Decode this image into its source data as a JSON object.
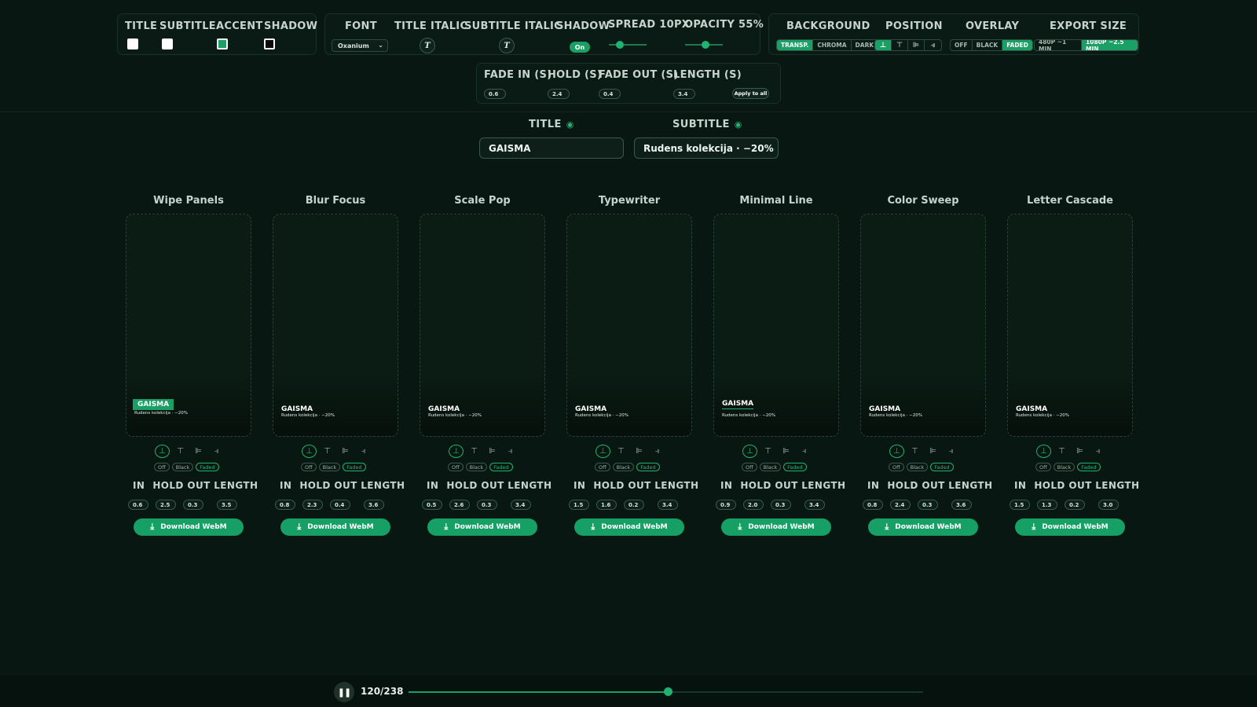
{
  "header": {
    "colors": {
      "labels": [
        "TITLE",
        "SUBTITLE",
        "ACCENT",
        "SHADOW"
      ],
      "values": [
        "#ffffff",
        "#ffffff",
        "#1aa065",
        "#0a0a0a"
      ]
    },
    "font": {
      "label": "FONT",
      "value": "Oxanium"
    },
    "title_italic": {
      "label": "TITLE ITALIC",
      "glyph": "T"
    },
    "subtitle_italic": {
      "label": "SUBTITLE ITALIC",
      "glyph": "T"
    },
    "shadow": {
      "label": "SHADOW",
      "value": "On"
    },
    "spread": {
      "label": "SPREAD 10PX",
      "level": 0.3
    },
    "opacity": {
      "label": "OPACITY 55%",
      "level": 0.55
    },
    "background": {
      "label": "BACKGROUND",
      "options": [
        "TRANSP.",
        "CHROMA",
        "DARK"
      ],
      "selected": 0
    },
    "position": {
      "label": "POSITION",
      "icons": [
        "align-bottom-icon",
        "align-top-icon",
        "align-left-icon",
        "align-right-icon"
      ],
      "selected": 0
    },
    "overlay": {
      "label": "OVERLAY",
      "options": [
        "OFF",
        "BLACK",
        "FADED"
      ],
      "selected": 2
    },
    "export_size": {
      "label": "EXPORT SIZE",
      "options": [
        "480P ~1 MIN",
        "1080P ~2.5 MIN"
      ],
      "selected": 1
    }
  },
  "timing": {
    "labels": [
      "FADE IN (S)",
      "HOLD (S)",
      "FADE OUT (S)",
      "LENGTH (S)"
    ],
    "values": [
      "0.6",
      "2.4",
      "0.4",
      "3.4"
    ],
    "apply_label": "Apply to all"
  },
  "fields": {
    "title_label": "TITLE",
    "title_value": "GAISMA",
    "subtitle_label": "SUBTITLE",
    "subtitle_value": "Rudens kolekcija · −20%"
  },
  "cards": [
    {
      "name": "Wipe Panels",
      "in": "0.6",
      "hold": "2.5",
      "out": "0.3",
      "length": "3.5"
    },
    {
      "name": "Blur Focus",
      "in": "0.8",
      "hold": "2.3",
      "out": "0.4",
      "length": "3.6"
    },
    {
      "name": "Scale Pop",
      "in": "0.5",
      "hold": "2.6",
      "out": "0.3",
      "length": "3.4"
    },
    {
      "name": "Typewriter",
      "in": "1.5",
      "hold": "1.6",
      "out": "0.2",
      "length": "3.4"
    },
    {
      "name": "Minimal Line",
      "in": "0.9",
      "hold": "2.0",
      "out": "0.3",
      "length": "3.4"
    },
    {
      "name": "Color Sweep",
      "in": "0.8",
      "hold": "2.4",
      "out": "0.3",
      "length": "3.6"
    },
    {
      "name": "Letter Cascade",
      "in": "1.5",
      "hold": "1.3",
      "out": "0.2",
      "length": "3.0"
    }
  ],
  "card_common": {
    "preview_title": "GAISMA",
    "preview_subtitle": "Rudens kolekcija · −20%",
    "overlay_options": [
      "Off",
      "Black",
      "Faded"
    ],
    "timing_labels": [
      "IN",
      "HOLD",
      "OUT",
      "LENGTH"
    ],
    "download_label": "Download WebM"
  },
  "player": {
    "frame": "120/238",
    "progress": 0.504
  }
}
